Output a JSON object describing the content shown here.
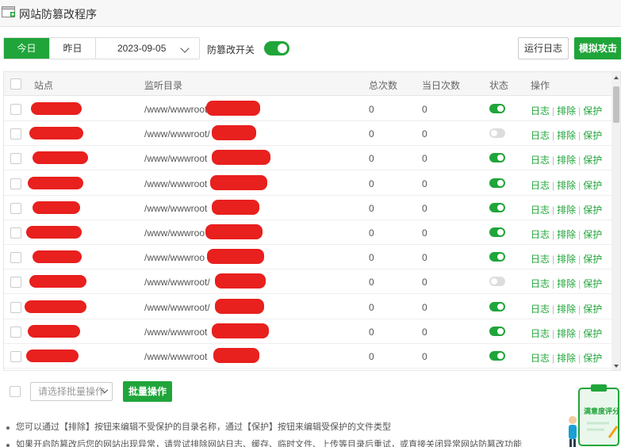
{
  "window": {
    "title": "网站防篡改程序"
  },
  "toolbar": {
    "today_label": "今日",
    "yesterday_label": "昨日",
    "date_value": "2023-09-05",
    "toggle_label": "防篡改开关",
    "toggle_on": true,
    "run_log_label": "运行日志",
    "simulate_attack_label": "模拟攻击"
  },
  "table": {
    "headers": {
      "site": "站点",
      "dir": "监听目录",
      "total": "总次数",
      "today": "当日次数",
      "status": "状态",
      "ops": "操作"
    },
    "rows": [
      {
        "dir": "/www/wwwroot",
        "total": "0",
        "today": "0",
        "status": "on"
      },
      {
        "dir": "/www/wwwroot/",
        "total": "0",
        "today": "0",
        "status": "off"
      },
      {
        "dir": "/www/wwwroot",
        "total": "0",
        "today": "0",
        "status": "on"
      },
      {
        "dir": "/www/wwwroot",
        "total": "0",
        "today": "0",
        "status": "on"
      },
      {
        "dir": "/www/wwwroot",
        "total": "0",
        "today": "0",
        "status": "on"
      },
      {
        "dir": "/www/wwwroo",
        "total": "0",
        "today": "0",
        "status": "on"
      },
      {
        "dir": "/www/wwwroo",
        "total": "0",
        "today": "0",
        "status": "on"
      },
      {
        "dir": "/www/wwwroot/",
        "total": "0",
        "today": "0",
        "status": "off"
      },
      {
        "dir": "/www/wwwroot/",
        "total": "0",
        "today": "0",
        "status": "on"
      },
      {
        "dir": "/www/wwwroot",
        "total": "0",
        "today": "0",
        "status": "on"
      },
      {
        "dir": "/www/wwwroot",
        "total": "0",
        "today": "0",
        "status": "on"
      }
    ],
    "ops": {
      "log": "日志",
      "exclude": "排除",
      "protect": "保护",
      "separator": "|"
    }
  },
  "bottom": {
    "batch_placeholder": "请选择批量操作",
    "batch_button": "批量操作"
  },
  "notes": [
    "您可以通过【排除】按钮来编辑不受保护的目录名称，通过【保护】按钮来编辑受保护的文件类型",
    "如果开启防篡改后您的网站出现异常，请尝试排除网站日志、缓存、临时文件、上传等目录后重试，或直接关闭异常网站防篡改功能"
  ],
  "badge": {
    "text": "满意度评分"
  },
  "colors": {
    "accent": "#20a53a",
    "redaction": "#e8201e",
    "toggle_off": "#dddddd"
  }
}
